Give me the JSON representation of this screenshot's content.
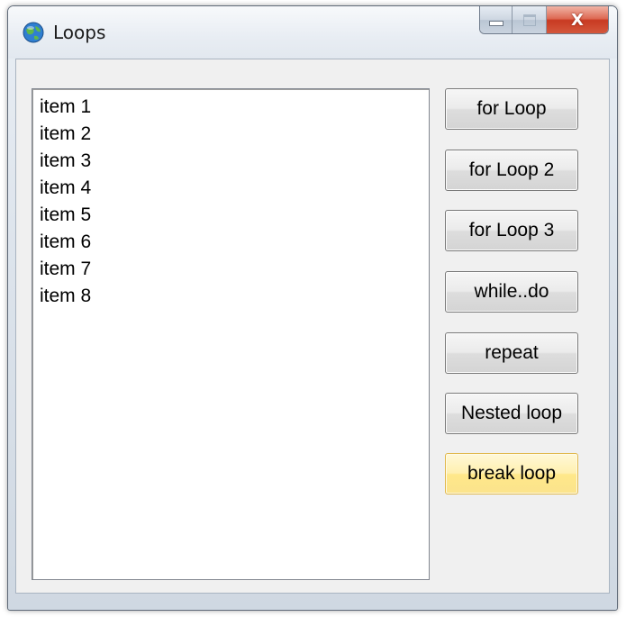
{
  "window": {
    "title": "Loops",
    "app_icon": "globe-app-icon",
    "caption": {
      "minimize_icon": "minimize-icon",
      "maximize_icon": "maximize-icon",
      "close_icon": "close-icon",
      "close_glyph": "X"
    }
  },
  "listbox": {
    "items": [
      "item 1",
      "item 2",
      "item 3",
      "item 4",
      "item 5",
      "item 6",
      "item 7",
      "item 8"
    ]
  },
  "buttons": {
    "for_loop": "for Loop",
    "for_loop_2": "for Loop 2",
    "for_loop_3": "for Loop 3",
    "while_do": "while..do",
    "repeat": "repeat",
    "nested_loop": "Nested loop",
    "break_loop": "break loop"
  },
  "colors": {
    "close_button": "#c83a22",
    "hover_button": "#ffe88a"
  }
}
